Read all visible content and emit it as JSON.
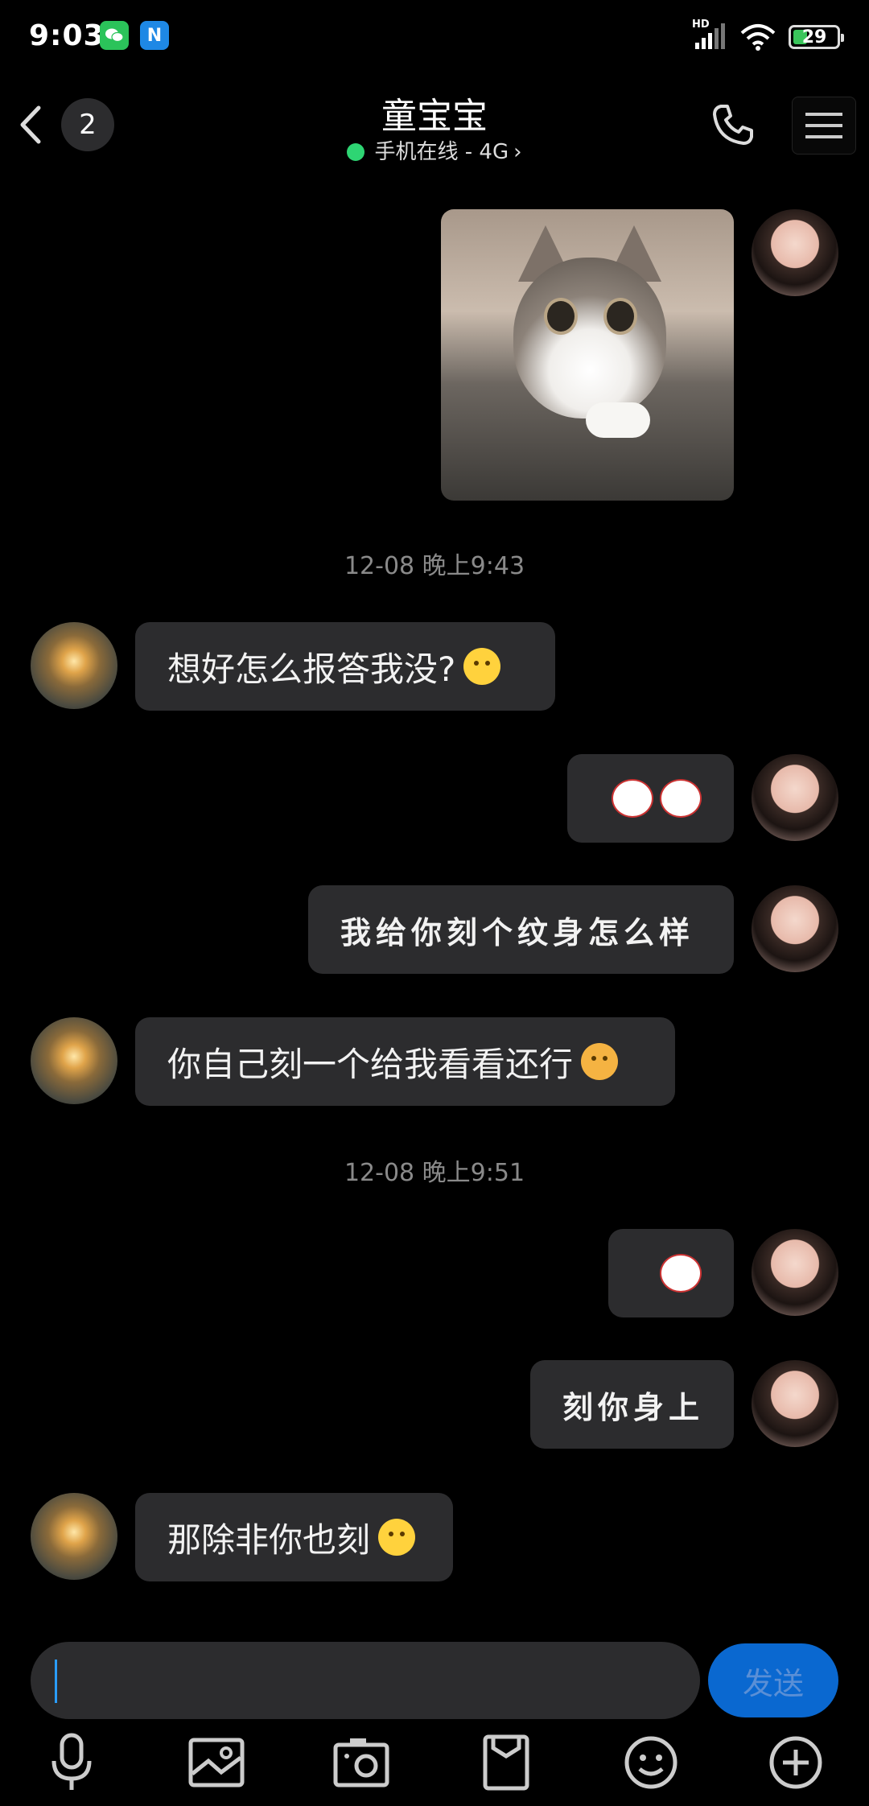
{
  "status_bar": {
    "time": "9:03",
    "apps": [
      "wechat-icon",
      "n-app-icon"
    ],
    "n_letter": "N",
    "signal_label": "HD",
    "battery": "29",
    "battery_level": 0.29
  },
  "header": {
    "unread_count": "2",
    "contact_name": "童宝宝",
    "online_status": "手机在线 - 4G",
    "status_dot_color": "#2ed573"
  },
  "messages": [
    {
      "from": "me",
      "type": "image",
      "description": "cat-photo"
    },
    {
      "type": "timestamp",
      "text": "12-08 晚上9:43"
    },
    {
      "from": "peer",
      "type": "text",
      "text": "想好怎么报答我没?"
    },
    {
      "from": "me",
      "type": "sticker"
    },
    {
      "from": "me",
      "type": "text",
      "text": "我给你刻个纹身怎么样"
    },
    {
      "from": "peer",
      "type": "text",
      "text": "你自己刻一个给我看看还行"
    },
    {
      "type": "timestamp",
      "text": "12-08 晚上9:51"
    },
    {
      "from": "me",
      "type": "sticker"
    },
    {
      "from": "me",
      "type": "text",
      "text": "刻你身上"
    },
    {
      "from": "peer",
      "type": "text",
      "text": "那除非你也刻"
    }
  ],
  "input": {
    "value": "",
    "send_label": "发送",
    "send_color": "#0a68d0"
  },
  "toolbar": {
    "icons": [
      "microphone-icon",
      "image-icon",
      "camera-icon",
      "file-icon",
      "emoji-icon",
      "plus-icon"
    ]
  }
}
